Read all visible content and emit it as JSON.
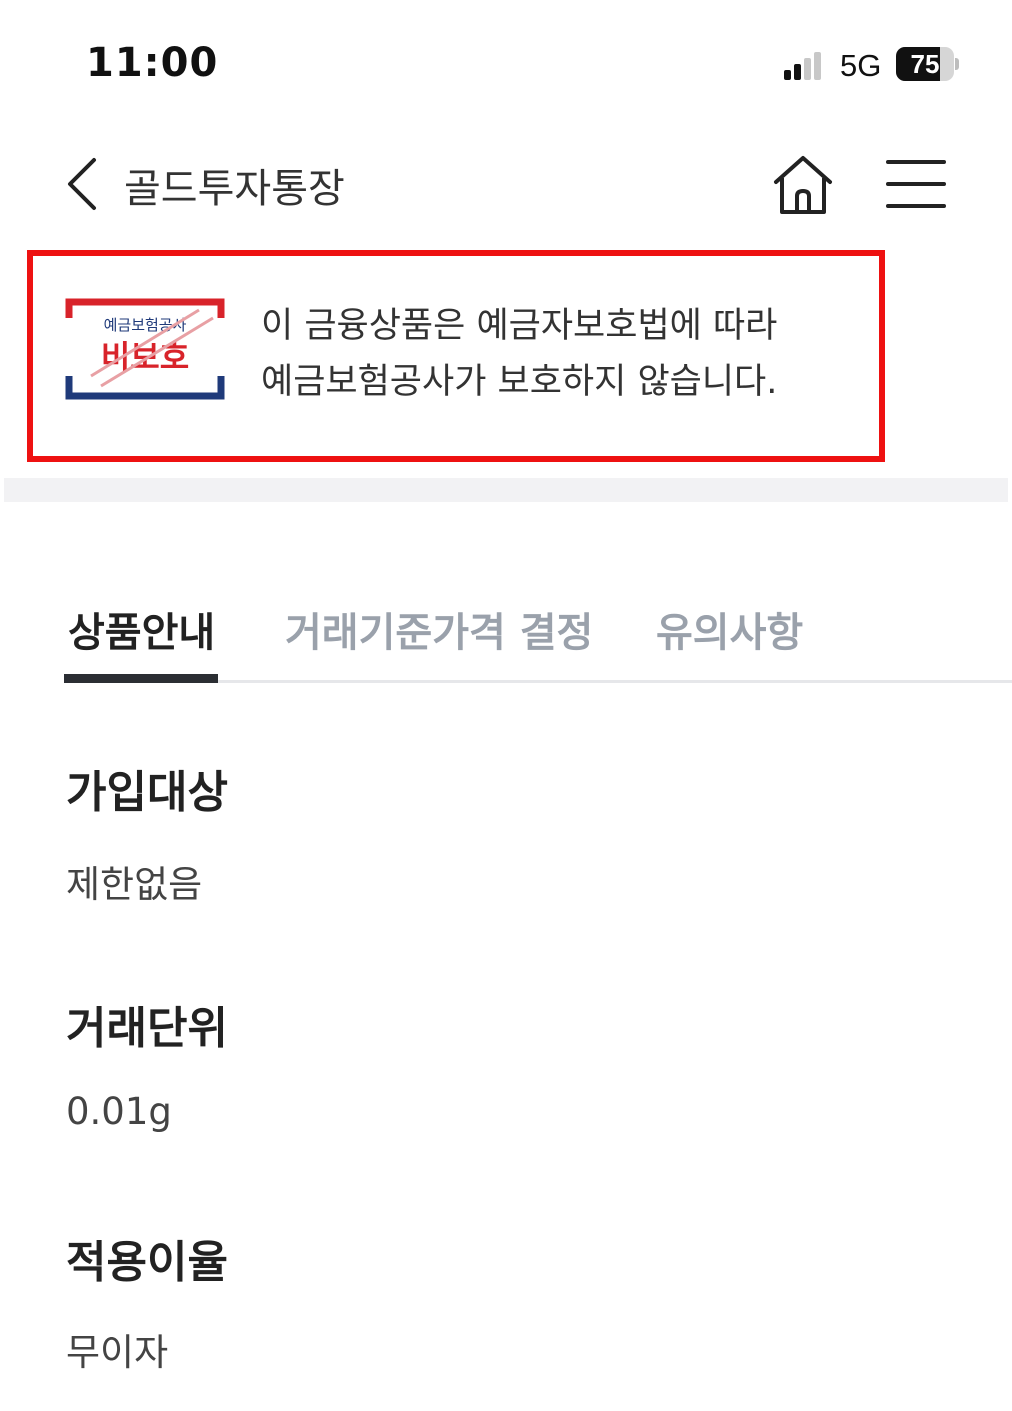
{
  "status_bar": {
    "time": "11:00",
    "network": "5G",
    "battery": "75",
    "battery_fraction": 0.75
  },
  "header": {
    "title": "골드투자통장"
  },
  "notice": {
    "badge_top": "예금보험공사",
    "badge_main": "비보호",
    "line1": "이 금융상품은 예금자보호법에 따라",
    "line2": "예금보험공사가 보호하지 않습니다."
  },
  "tabs": [
    {
      "label": "상품안내"
    },
    {
      "label": "거래기준가격 결정"
    },
    {
      "label": "유의사항"
    }
  ],
  "sections": [
    {
      "title": "가입대상",
      "value": "제한없음"
    },
    {
      "title": "거래단위",
      "value": "0.01g"
    },
    {
      "title": "적용이율",
      "value": "무이자"
    }
  ],
  "colors": {
    "notice_border": "#ee1111",
    "badge_red": "#d8232a",
    "badge_navy": "#1f3a7a",
    "tab_inactive": "#9aa1ab"
  }
}
